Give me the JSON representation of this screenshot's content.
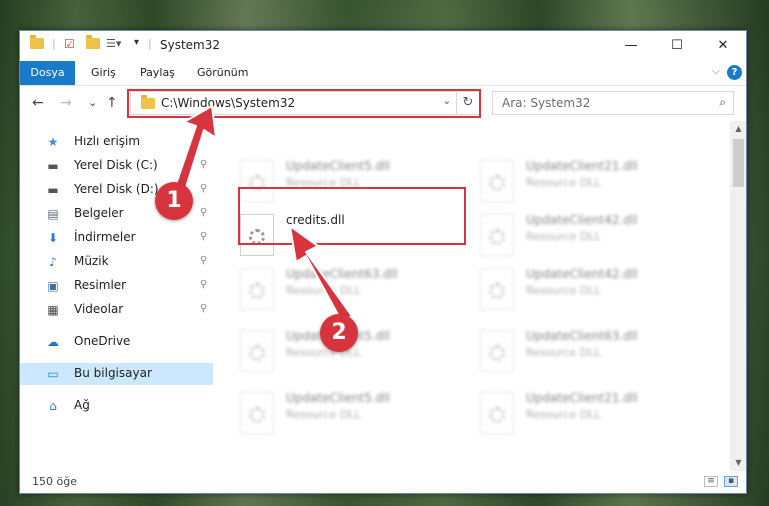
{
  "window": {
    "title": "System32",
    "minimize": "—",
    "maximize": "☐",
    "close": "✕"
  },
  "ribbon": {
    "tabs": [
      "Dosya",
      "Giriş",
      "Paylaş",
      "Görünüm"
    ],
    "expand": "⌵",
    "help": "?"
  },
  "nav": {
    "back": "←",
    "forward": "→",
    "recent": "⌄",
    "up": "↑",
    "address": "C:\\Windows\\System32",
    "address_dropdown": "⌄",
    "refresh": "↻",
    "search_placeholder": "Ara: System32",
    "search_icon": "⌕"
  },
  "sidebar": {
    "items": [
      {
        "label": "Hızlı erişim",
        "icon": "★",
        "icon_color": "#3a8bd6",
        "pinned": false
      },
      {
        "label": "Yerel Disk (C:)",
        "icon": "▬",
        "icon_color": "#555555",
        "pinned": true
      },
      {
        "label": "Yerel Disk (D:)",
        "icon": "▬",
        "icon_color": "#555555",
        "pinned": true
      },
      {
        "label": "Belgeler",
        "icon": "▤",
        "icon_color": "#5a6b7b",
        "pinned": true
      },
      {
        "label": "İndirmeler",
        "icon": "⬇",
        "icon_color": "#2f7bd1",
        "pinned": true
      },
      {
        "label": "Müzik",
        "icon": "♪",
        "icon_color": "#2f7bd1",
        "pinned": true
      },
      {
        "label": "Resimler",
        "icon": "▣",
        "icon_color": "#3a6fa8",
        "pinned": true
      },
      {
        "label": "Videolar",
        "icon": "▦",
        "icon_color": "#444444",
        "pinned": true
      },
      {
        "label": "OneDrive",
        "icon": "☁",
        "icon_color": "#1979ca",
        "pinned": false
      },
      {
        "label": "Bu bilgisayar",
        "icon": "▭",
        "icon_color": "#2f7bd1",
        "pinned": false,
        "selected": true
      },
      {
        "label": "Ağ",
        "icon": "⌂",
        "icon_color": "#2f7bd1",
        "pinned": false
      }
    ],
    "pin_glyph": "📌"
  },
  "files": {
    "left_column": [
      {
        "name": "UpdateClient5.dll",
        "type": "Resource DLL",
        "blurred": true
      },
      {
        "name": "credits.dll",
        "type": "",
        "blurred": false,
        "highlighted": true
      },
      {
        "name": "UpdateClient63.dll",
        "type": "Resource DLL",
        "blurred": true
      },
      {
        "name": "UpdateClient5.dll",
        "type": "Resource DLL",
        "blurred": true
      },
      {
        "name": "UpdateClient5.dll",
        "type": "Resource DLL",
        "blurred": true
      }
    ],
    "right_column": [
      {
        "name": "UpdateClient21.dll",
        "type": "Resource DLL",
        "blurred": true
      },
      {
        "name": "UpdateClient42.dll",
        "type": "Resource DLL",
        "blurred": true
      },
      {
        "name": "UpdateClient42.dll",
        "type": "Resource DLL",
        "blurred": true
      },
      {
        "name": "UpdateClient63.dll",
        "type": "Resource DLL",
        "blurred": true
      },
      {
        "name": "UpdateClient21.dll",
        "type": "Resource DLL",
        "blurred": true
      }
    ]
  },
  "status": {
    "count": "150 öğe"
  },
  "annotations": {
    "badge1": "1",
    "badge2": "2",
    "accent_color": "#d8343d"
  },
  "colors": {
    "ribbon_file_tab": "#1979ca",
    "selection": "#cce8ff"
  }
}
